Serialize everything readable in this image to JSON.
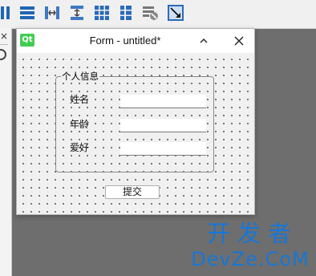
{
  "toolbar": {
    "icons": [
      "layout-horizontal-icon",
      "layout-vertical-icon",
      "layout-horizontal-splitter-icon",
      "layout-vertical-splitter-icon",
      "layout-grid-icon",
      "layout-form-icon",
      "break-layout-icon",
      "adjust-size-icon"
    ]
  },
  "window": {
    "logo_text": "Qt",
    "title": "Form - untitled*",
    "minimize_icon": "chevron-up-icon",
    "close_icon": "close-icon"
  },
  "left_panel": {
    "close_glyph": "×",
    "icon": "target-icon"
  },
  "groupbox": {
    "title": "个人信息",
    "fields": [
      {
        "label": "姓名",
        "value": ""
      },
      {
        "label": "年龄",
        "value": ""
      },
      {
        "label": "爱好",
        "value": ""
      }
    ]
  },
  "submit_label": "提交",
  "watermark": {
    "line1": "开发者",
    "line2": "DevZe.CoM"
  },
  "colors": {
    "accent": "#1876d6",
    "qt_green": "#41cd52",
    "canvas_bg": "#f0f0f0",
    "workspace_bg": "#6e6e6e"
  }
}
